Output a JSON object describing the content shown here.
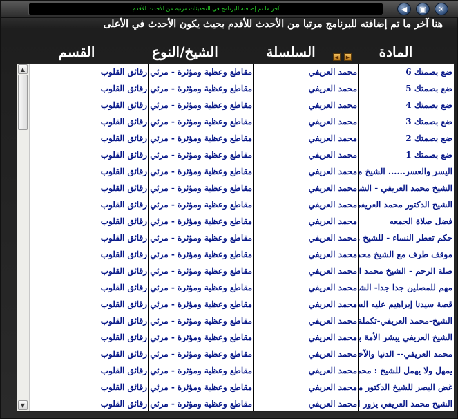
{
  "window": {
    "title_text": "آخر ما تم إضافته للبرنامج في التحديثات مرتبة من الأحدث للأقدم",
    "buttons": [
      "close",
      "maximize",
      "minimize"
    ]
  },
  "header": {
    "description": "هنا آخر ما تم إضافته للبرنامج مرتبا من الأحدث للأقدم بحيث يكون الأحدث في الأعلى"
  },
  "columns": {
    "mada": "المادة",
    "series": "السلسلة",
    "sheikh": "الشيخ/النوع",
    "qism": "القسم"
  },
  "rows": [
    {
      "mada": "ضع بصمتك 6",
      "series": "محمد العريفي",
      "sheikh": "مقاطع وعظية ومؤثرة - مرئي",
      "qism": "رقائق القلوب"
    },
    {
      "mada": "ضع بصمتك 5",
      "series": "محمد العريفي",
      "sheikh": "مقاطع وعظية ومؤثرة - مرئي",
      "qism": "رقائق القلوب"
    },
    {
      "mada": "ضع بصمتك 4",
      "series": "محمد العريفي",
      "sheikh": "مقاطع وعظية ومؤثرة - مرئي",
      "qism": "رقائق القلوب"
    },
    {
      "mada": "ضع بصمتك 3",
      "series": "محمد العريفي",
      "sheikh": "مقاطع وعظية ومؤثرة - مرئي",
      "qism": "رقائق القلوب"
    },
    {
      "mada": "ضع بصمتك 2",
      "series": "محمد العريفي",
      "sheikh": "مقاطع وعظية ومؤثرة - مرئي",
      "qism": "رقائق القلوب"
    },
    {
      "mada": "ضع بصمتك 1",
      "series": "محمد العريفي",
      "sheikh": "مقاطع وعظية ومؤثرة - مرئي",
      "qism": "رقائق القلوب"
    },
    {
      "mada": "اليسر والعسر...... الشيخ محمد",
      "series": "محمد العريفي",
      "sheikh": "مقاطع وعظية ومؤثرة - مرئي",
      "qism": "رقائق القلوب"
    },
    {
      "mada": "الشيخ محمد العريفي - الشهوات",
      "series": "محمد العريفي",
      "sheikh": "مقاطع وعظية ومؤثرة - مرئي",
      "qism": "رقائق القلوب"
    },
    {
      "mada": "الشيخ الدكتور محمد العريفي لأهل",
      "series": "محمد العريفي",
      "sheikh": "مقاطع وعظية ومؤثرة - مرئي",
      "qism": "رقائق القلوب"
    },
    {
      "mada": "فضل صلاة الجمعه",
      "series": "محمد العريفي",
      "sheikh": "مقاطع وعظية ومؤثرة - مرئي",
      "qism": "رقائق القلوب"
    },
    {
      "mada": "حكم تعطر النساء - للشيخ محمد",
      "series": "محمد العريفي",
      "sheikh": "مقاطع وعظية ومؤثرة - مرئي",
      "qism": "رقائق القلوب"
    },
    {
      "mada": "موقف طرف مع الشيخ محمد العر",
      "series": "محمد العريفي",
      "sheikh": "مقاطع وعظية ومؤثرة - مرئي",
      "qism": "رقائق القلوب"
    },
    {
      "mada": "صلة الرحم - الشيخ محمد العريف",
      "series": "محمد العريفي",
      "sheikh": "مقاطع وعظية ومؤثرة - مرئي",
      "qism": "رقائق القلوب"
    },
    {
      "mada": "مهم للمصلين جدا جدا- الشيخ",
      "series": "محمد العريفي",
      "sheikh": "مقاطع وعظية ومؤثرة - مرئي",
      "qism": "رقائق القلوب"
    },
    {
      "mada": "قصة سيدنا إبراهيم عليه السلام و",
      "series": "محمد العريفي",
      "sheikh": "مقاطع وعظية ومؤثرة - مرئي",
      "qism": "رقائق القلوب"
    },
    {
      "mada": "الشيخ-محمد العريفي-تكملة نسخ",
      "series": "محمد العريفي",
      "sheikh": "مقاطع وعظية ومؤثرة - مرئي",
      "qism": "رقائق القلوب"
    },
    {
      "mada": "الشيخ العريفي يبشر الأمة بإقبال",
      "series": "محمد العريفي",
      "sheikh": "مقاطع وعظية ومؤثرة - مرئي",
      "qism": "رقائق القلوب"
    },
    {
      "mada": "محمد العريفي-- الدنيا والآخرة و",
      "series": "محمد العريفي",
      "sheikh": "مقاطع وعظية ومؤثرة - مرئي",
      "qism": "رقائق القلوب"
    },
    {
      "mada": "يمهل ولا يهمل للشيخ : محمد العر",
      "series": "محمد العريفي",
      "sheikh": "مقاطع وعظية ومؤثرة - مرئي",
      "qism": "رقائق القلوب"
    },
    {
      "mada": "غض البصر للشيخ الدكتور محمد",
      "series": "محمد العريفي",
      "sheikh": "مقاطع وعظية ومؤثرة - مرئي",
      "qism": "رقائق القلوب"
    },
    {
      "mada": "الشيخ محمد العريفي يزور المرضى",
      "series": "محمد العريفي",
      "sheikh": "مقاطع وعظية ومؤثرة - مرئي",
      "qism": "رقائق القلوب"
    }
  ]
}
